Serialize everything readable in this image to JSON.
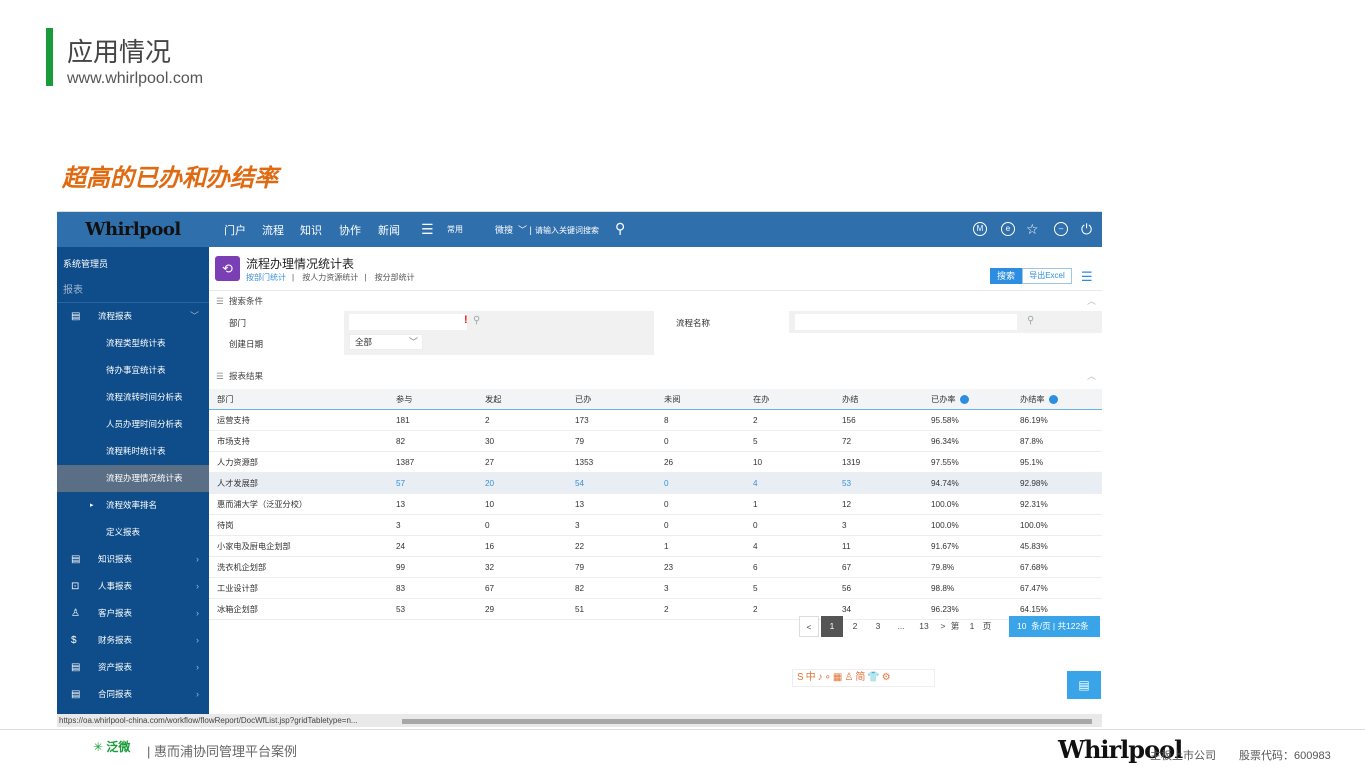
{
  "slide": {
    "title": "应用情况",
    "url": "www.whirlpool.com",
    "subtitle": "超高的已办和办结率"
  },
  "app": {
    "logo": "Whirlpool",
    "nav": [
      "门户",
      "流程",
      "知识",
      "协作",
      "新闻",
      "常用",
      "微搜"
    ],
    "search_placeholder": "请输入关键词搜索",
    "icon_m": "M",
    "icon_e": "e"
  },
  "sidebar": {
    "admin": "系统管理员",
    "section": "报表",
    "items": [
      {
        "label": "流程报表",
        "icon": "doc-icon"
      },
      {
        "label": "流程类型统计表"
      },
      {
        "label": "待办事宜统计表"
      },
      {
        "label": "流程流转时间分析表"
      },
      {
        "label": "人员办理时间分析表"
      },
      {
        "label": "流程耗时统计表"
      },
      {
        "label": "流程办理情况统计表"
      },
      {
        "label": "流程效率排名"
      },
      {
        "label": "定义报表"
      },
      {
        "label": "知识报表",
        "icon": "doc-icon"
      },
      {
        "label": "人事报表",
        "icon": "person-card-icon"
      },
      {
        "label": "客户报表",
        "icon": "user-icon"
      },
      {
        "label": "财务报表",
        "icon": "dollar-icon"
      },
      {
        "label": "资产报表",
        "icon": "doc-icon"
      },
      {
        "label": "合同报表",
        "icon": "doc-icon"
      }
    ]
  },
  "report": {
    "title": "流程办理情况统计表",
    "tabs": [
      "按部门统计",
      "按人力资源统计",
      "按分部统计"
    ],
    "search_button": "搜索",
    "export_button": "导出Excel",
    "search_section": "搜索条件",
    "dept_label": "部门",
    "flow_name_label": "流程名称",
    "created_date_label": "创建日期",
    "created_date_value": "全部",
    "result_section": "报表结果",
    "columns": [
      "部门",
      "参与",
      "发起",
      "已办",
      "未阅",
      "在办",
      "办结",
      "已办率",
      "办结率"
    ],
    "rows": [
      [
        "运营支持",
        "181",
        "2",
        "173",
        "8",
        "2",
        "156",
        "95.58%",
        "86.19%"
      ],
      [
        "市场支持",
        "82",
        "30",
        "79",
        "0",
        "5",
        "72",
        "96.34%",
        "87.8%"
      ],
      [
        "人力资源部",
        "1387",
        "27",
        "1353",
        "26",
        "10",
        "1319",
        "97.55%",
        "95.1%"
      ],
      [
        "人才发展部",
        "57",
        "20",
        "54",
        "0",
        "4",
        "53",
        "94.74%",
        "92.98%"
      ],
      [
        "惠而浦大学（泛亚分校）",
        "13",
        "10",
        "13",
        "0",
        "1",
        "12",
        "100.0%",
        "92.31%"
      ],
      [
        "待岗",
        "3",
        "0",
        "3",
        "0",
        "0",
        "3",
        "100.0%",
        "100.0%"
      ],
      [
        "小家电及厨电企划部",
        "24",
        "16",
        "22",
        "1",
        "4",
        "11",
        "91.67%",
        "45.83%"
      ],
      [
        "洗衣机企划部",
        "99",
        "32",
        "79",
        "23",
        "6",
        "67",
        "79.8%",
        "67.68%"
      ],
      [
        "工业设计部",
        "83",
        "67",
        "82",
        "3",
        "5",
        "56",
        "98.8%",
        "67.47%"
      ],
      [
        "冰箱企划部",
        "53",
        "29",
        "51",
        "2",
        "2",
        "34",
        "96.23%",
        "64.15%"
      ]
    ],
    "highlight_row": 3,
    "pager": {
      "prev": "<",
      "pages": [
        "1",
        "2",
        "3",
        "...",
        "13"
      ],
      "next": ">",
      "goto_prefix": "第",
      "goto_value": "1",
      "goto_suffix": "页",
      "size": "10",
      "size_text": "条/页 | 共122条"
    }
  },
  "status_url": "https://oa.whirlpool-china.com/workflow/flowReport/DocWfList.jsp?gridTabletype=n...",
  "ime_bar": "S中♪∘▦♙简👕⚙",
  "footer": {
    "logo_text": "泛微",
    "desc": "| 惠而浦协同管理平台案例",
    "brand": "Whirlpool",
    "market": "主板上市公司",
    "stock": "股票代码：600983"
  }
}
